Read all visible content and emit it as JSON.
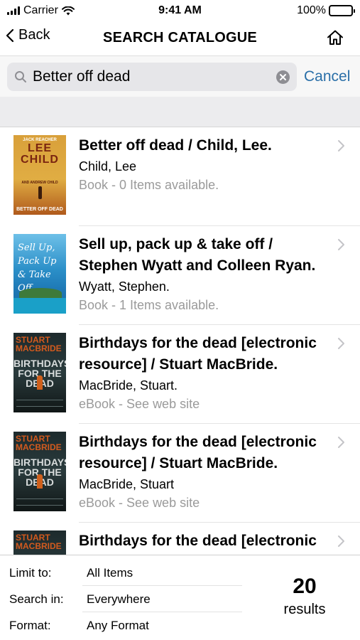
{
  "status_bar": {
    "carrier": "Carrier",
    "time": "9:41 AM",
    "battery": "100%"
  },
  "nav": {
    "back_label": "Back",
    "title": "SEARCH CATALOGUE"
  },
  "search": {
    "query": "Better off dead",
    "cancel_label": "Cancel"
  },
  "results": [
    {
      "title": "Better off dead / Child, Lee.",
      "author": "Child, Lee",
      "meta": "Book - 0 Items available.",
      "cover": {
        "series": "JACK REACHER",
        "author_line": "LEE CHILD",
        "coauthor": "AND ANDREW CHILD",
        "title": "BETTER OFF DEAD"
      }
    },
    {
      "title": "Sell up, pack up & take off / Stephen Wyatt and Colleen Ryan.",
      "author": "Wyatt, Stephen.",
      "meta": "Book - 1 Items available.",
      "cover": {
        "title": "Sell Up, Pack Up & Take Off"
      }
    },
    {
      "title": "Birthdays for the dead [electronic resource] / Stuart MacBride.",
      "author": "MacBride, Stuart.",
      "meta": "eBook - See web site",
      "cover": {
        "author_line": "STUART MACBRIDE",
        "title": "BIRTHDAYS FOR THE DEAD"
      }
    },
    {
      "title": "Birthdays for the dead [electronic resource] / Stuart MacBride.",
      "author": "MacBride, Stuart",
      "meta": "eBook - See web site",
      "cover": {
        "author_line": "STUART MACBRIDE",
        "title": "BIRTHDAYS FOR THE DEAD"
      }
    },
    {
      "title": "Birthdays for the dead [electronic",
      "author": "",
      "meta": "",
      "cover": {
        "author_line": "STUART MACBRIDE",
        "title": ""
      }
    }
  ],
  "filters": {
    "limit": {
      "label": "Limit to:",
      "value": "All Items"
    },
    "search_in": {
      "label": "Search in:",
      "value": "Everywhere"
    },
    "format": {
      "label": "Format:",
      "value": "Any Format"
    }
  },
  "result_count": {
    "number": "20",
    "label": "results"
  },
  "colors": {
    "accent": "#2a6fa8",
    "meta_text": "#9a9a9a",
    "search_bg": "#e6e6e9",
    "strip_bg": "#ececee"
  },
  "icons": [
    "signal-icon",
    "wifi-icon",
    "battery-icon",
    "back-chevron-icon",
    "home-icon",
    "search-icon",
    "clear-icon",
    "chevron-right-icon"
  ]
}
